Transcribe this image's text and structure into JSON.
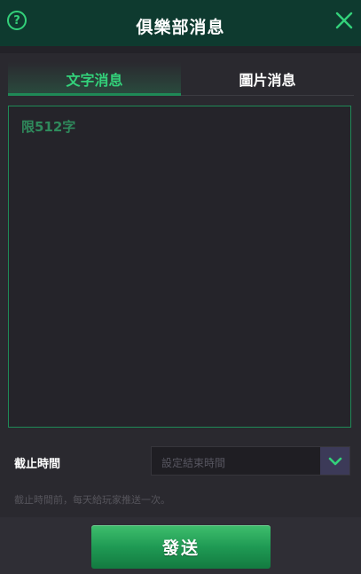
{
  "header": {
    "title": "俱樂部消息",
    "help_icon": "help-circle-icon",
    "close_icon": "close-icon",
    "help_glyph": "?"
  },
  "tabs": [
    {
      "label": "文字消息",
      "active": true
    },
    {
      "label": "圖片消息",
      "active": false
    }
  ],
  "message": {
    "value": "",
    "placeholder": "限512字"
  },
  "deadline": {
    "label": "截止時間",
    "placeholder": "設定結束時間",
    "dropdown_icon": "chevron-down-icon"
  },
  "hint": "截止時間前，每天給玩家推送一次。",
  "send_label": "發送",
  "colors": {
    "header_bg": "#0e3a2f",
    "accent_green": "#33d17a",
    "panel_bg": "#2a292f",
    "dropdown_bg": "#3c3a58"
  }
}
